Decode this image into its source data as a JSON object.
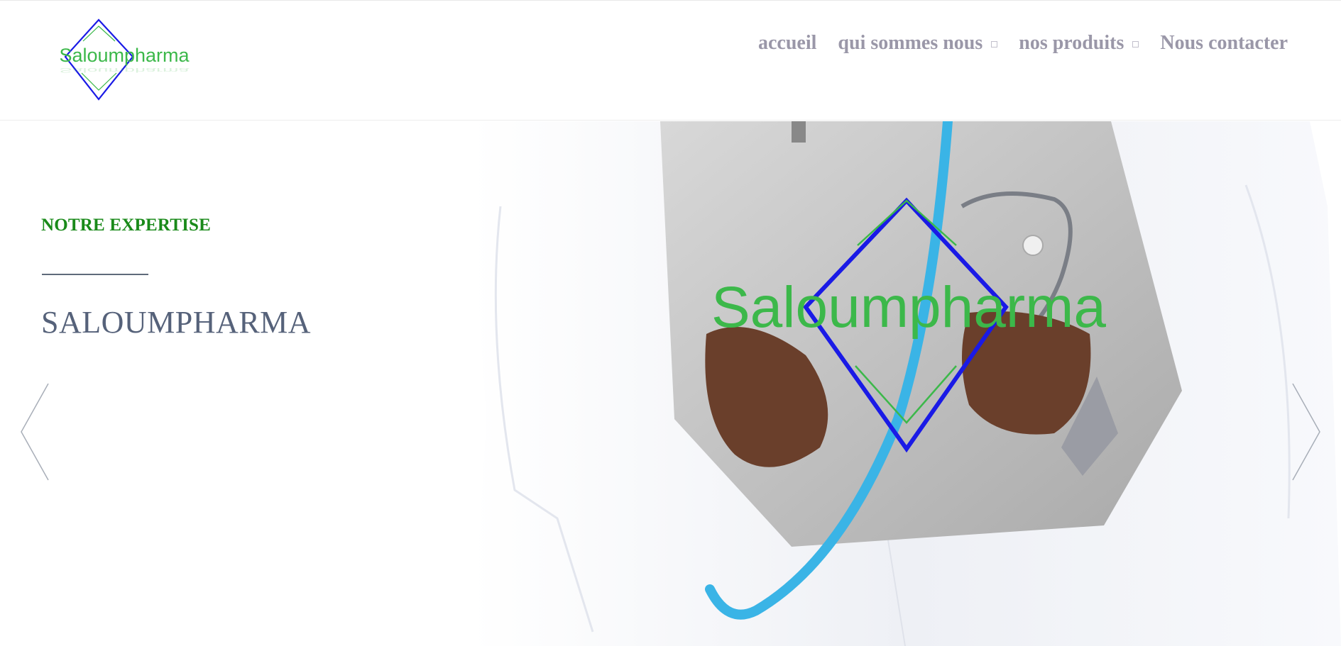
{
  "brand": {
    "logo_text": "Saloumpharma",
    "colors": {
      "green": "#3cb84a",
      "blue": "#1a1ae6"
    }
  },
  "nav": {
    "items": [
      {
        "label": "accueil",
        "has_dropdown": false
      },
      {
        "label": "qui sommes nous",
        "has_dropdown": true
      },
      {
        "label": "nos produits",
        "has_dropdown": true
      },
      {
        "label": "Nous contacter",
        "has_dropdown": false
      }
    ]
  },
  "hero": {
    "eyebrow": "NOTRE EXPERTISE",
    "title": "SALOUMPHARMA",
    "watermark_text": "Saloumpharma",
    "prev_icon": "chevron-left-icon",
    "next_icon": "chevron-right-icon"
  }
}
